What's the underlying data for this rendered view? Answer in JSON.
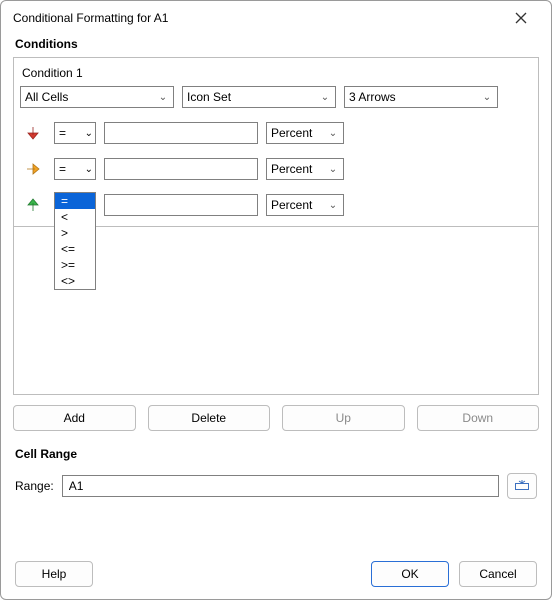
{
  "title": "Conditional Formatting for A1",
  "conditions_label": "Conditions",
  "condition_title": "Condition 1",
  "scope_value": "All Cells",
  "style_value": "Icon Set",
  "iconset_value": "3 Arrows",
  "rows": [
    {
      "arrow": "down",
      "color": "#d43a2f",
      "op": "=",
      "value": "",
      "type": "Percent"
    },
    {
      "arrow": "right",
      "color": "#f0a224",
      "op": "=",
      "value": "",
      "type": "Percent"
    },
    {
      "arrow": "up",
      "color": "#39b54a",
      "op": "=",
      "value": "",
      "type": "Percent",
      "dropdown_open": true
    }
  ],
  "operator_options": [
    "=",
    "<",
    ">",
    "<=",
    ">=",
    "<>"
  ],
  "buttons": {
    "add": "Add",
    "delete": "Delete",
    "up": "Up",
    "down": "Down"
  },
  "cell_range_label": "Cell Range",
  "range_label": "Range:",
  "range_value": "A1",
  "help": "Help",
  "ok": "OK",
  "cancel": "Cancel"
}
